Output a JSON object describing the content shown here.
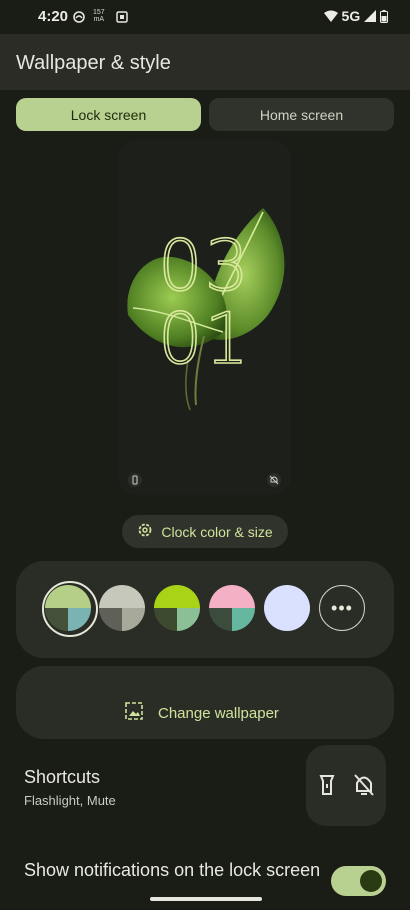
{
  "status_bar": {
    "time": "4:20",
    "ma_top": "157",
    "ma_bottom": "mA",
    "network": "5G"
  },
  "header": {
    "title": "Wallpaper & style"
  },
  "tabs": [
    {
      "label": "Lock screen",
      "selected": true
    },
    {
      "label": "Home screen",
      "selected": false
    }
  ],
  "preview": {
    "hours": "03",
    "minutes": "01"
  },
  "clock_button": {
    "label": "Clock color & size",
    "icon": "gear-icon"
  },
  "colors": {
    "swatches": [
      {
        "q": [
          "#b5cf86",
          "#b5cf86",
          "#44523b",
          "#79b4b2"
        ],
        "selected": true
      },
      {
        "q": [
          "#c6c8bb",
          "#c6c8bb",
          "#5f6158",
          "#a7a99a"
        ],
        "selected": false
      },
      {
        "q": [
          "#a9d317",
          "#a9d317",
          "#3d4a2f",
          "#8bbf95"
        ],
        "selected": false
      },
      {
        "q": [
          "#f4b0c4",
          "#f4b0c4",
          "#3b4b3c",
          "#66b7a0"
        ],
        "selected": false
      },
      {
        "q": [
          "#d9e1ff",
          "#d9e1ff",
          "#d9e1ff",
          "#d9e1ff"
        ],
        "selected": false
      }
    ],
    "more_label": "•••"
  },
  "wallpaper": {
    "label": "Change wallpaper"
  },
  "shortcuts": {
    "title": "Shortcuts",
    "subtitle": "Flashlight, Mute"
  },
  "notifications": {
    "label": "Show notifications on the lock screen",
    "enabled": true
  },
  "accent": "#b9d190"
}
